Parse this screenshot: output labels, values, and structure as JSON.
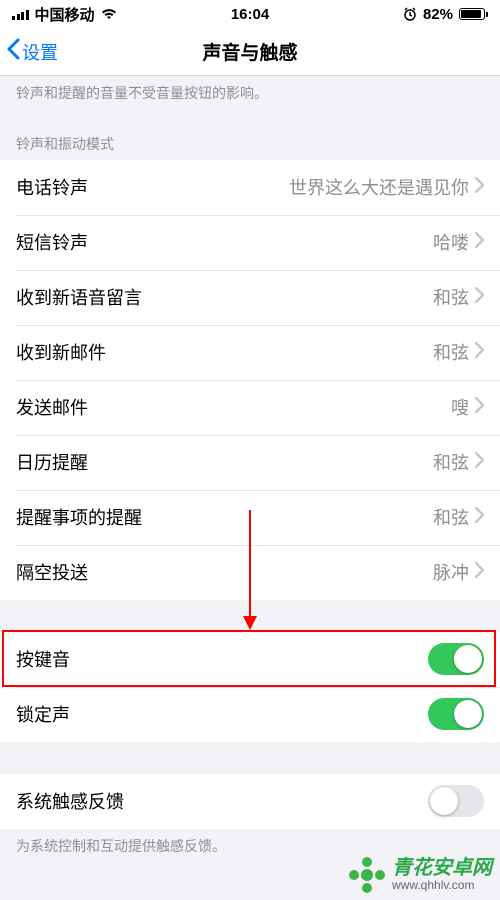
{
  "status": {
    "carrier": "中国移动",
    "time": "16:04",
    "battery_pct": "82%"
  },
  "nav": {
    "back_label": "设置",
    "title": "声音与触感"
  },
  "notes": {
    "ringer_note": "铃声和提醒的音量不受音量按钮的影响。",
    "haptic_note": "为系统控制和互动提供触感反馈。"
  },
  "section_headers": {
    "ring_vibrate": "铃声和振动模式"
  },
  "cells": {
    "ringtone": {
      "label": "电话铃声",
      "value": "世界这么大还是遇见你"
    },
    "text_tone": {
      "label": "短信铃声",
      "value": "哈喽"
    },
    "voicemail": {
      "label": "收到新语音留言",
      "value": "和弦"
    },
    "new_mail": {
      "label": "收到新邮件",
      "value": "和弦"
    },
    "sent_mail": {
      "label": "发送邮件",
      "value": "嗖"
    },
    "calendar": {
      "label": "日历提醒",
      "value": "和弦"
    },
    "reminder": {
      "label": "提醒事项的提醒",
      "value": "和弦"
    },
    "airdrop": {
      "label": "隔空投送",
      "value": "脉冲"
    }
  },
  "toggles": {
    "keyboard_clicks": {
      "label": "按键音",
      "on": true
    },
    "lock_sound": {
      "label": "锁定声",
      "on": true
    },
    "system_haptics": {
      "label": "系统触感反馈",
      "on": false
    }
  },
  "watermark": {
    "name": "青花安卓网",
    "url": "www.qhhlv.com"
  }
}
